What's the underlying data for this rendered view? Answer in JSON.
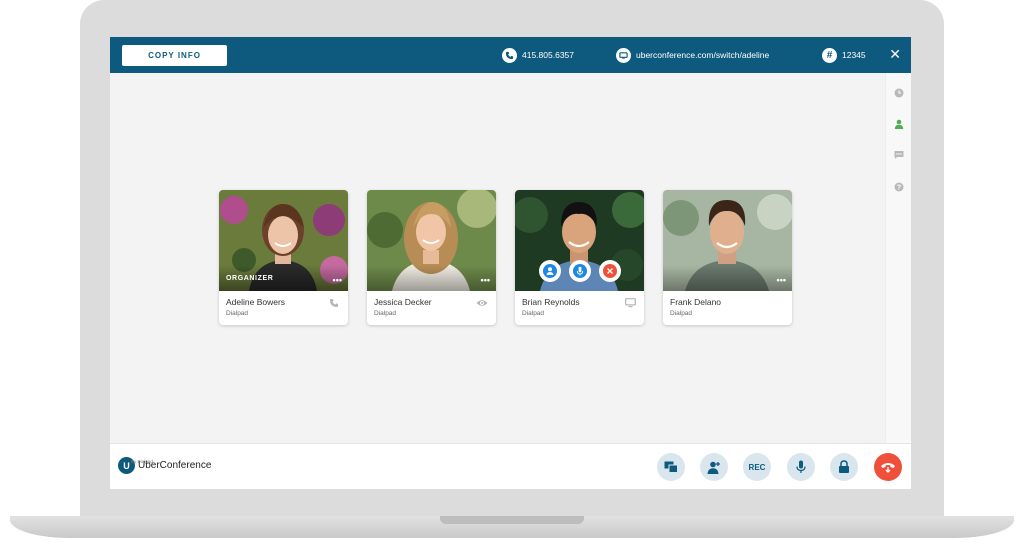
{
  "topbar": {
    "copy_label": "COPY INFO",
    "phone": "415.805.6357",
    "url": "uberconference.com/switch/adeline",
    "pin": "12345",
    "icons": [
      "phone-icon",
      "screen-icon",
      "hash-icon",
      "close-icon"
    ]
  },
  "rail": {
    "icons": [
      "clock-icon",
      "person-icon",
      "chat-icon",
      "help-icon"
    ],
    "active": "person-icon",
    "active_color": "#4caf50"
  },
  "participants": [
    {
      "name": "Adeline Bowers",
      "org": "Dialpad",
      "badge": "ORGANIZER",
      "status_icon": "phone-icon"
    },
    {
      "name": "Jessica Decker",
      "org": "Dialpad",
      "status_icon": "eye-icon"
    },
    {
      "name": "Brian Reynolds",
      "org": "Dialpad",
      "status_icon": "monitor-icon"
    },
    {
      "name": "Frank Delano",
      "org": "Dialpad",
      "status_icon": ""
    }
  ],
  "bottombar": {
    "brand": "UberConference",
    "brand_sub": "By Dialpad",
    "rec_label": "REC",
    "controls": [
      "screenshare-icon",
      "add-person-icon",
      "rec-button",
      "mic-icon",
      "lock-icon",
      "hangup-icon"
    ]
  },
  "colors": {
    "brand": "#0e5a7e",
    "hangup": "#f0503a",
    "control_bg": "#d9e6ee",
    "hover_person": "#1e88e5",
    "hover_remove": "#f0503a"
  }
}
